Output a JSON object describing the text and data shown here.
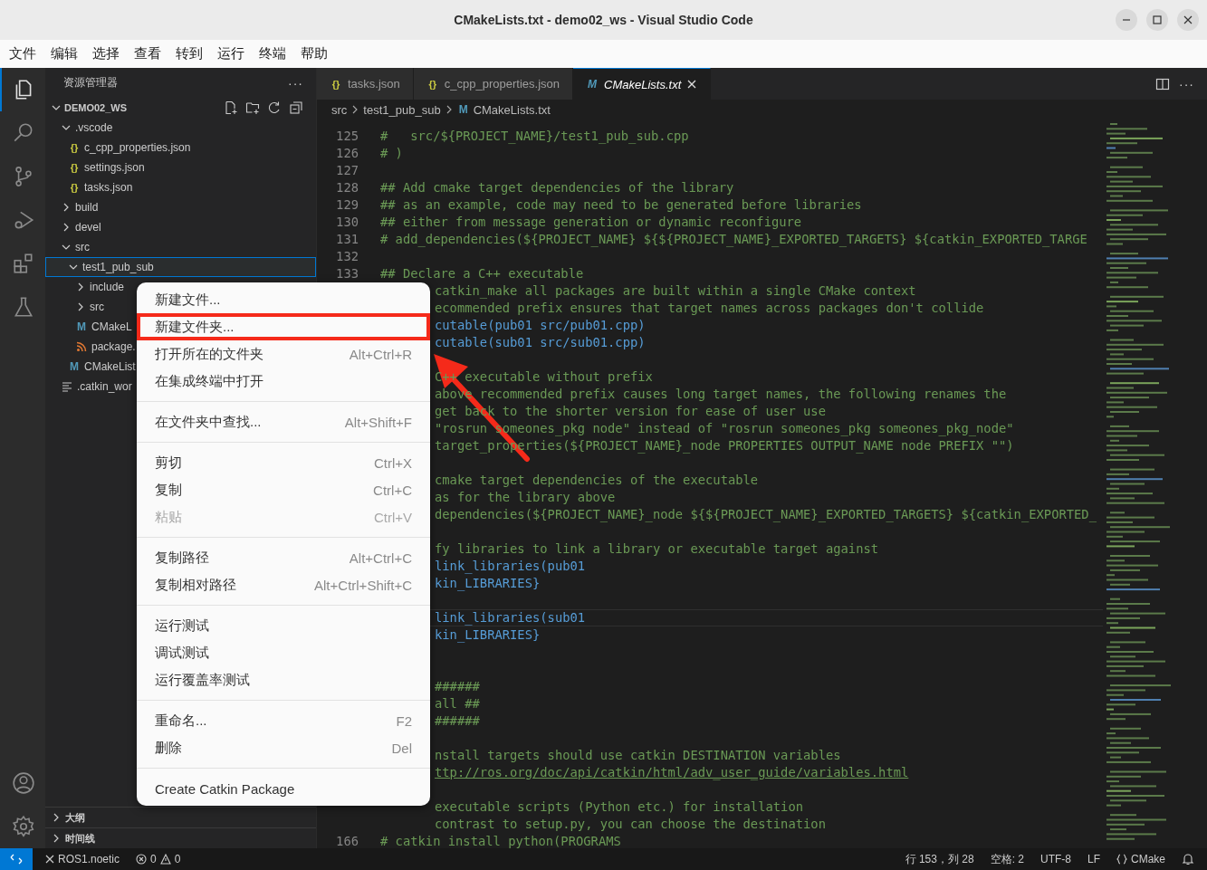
{
  "window": {
    "title": "CMakeLists.txt - demo02_ws - Visual Studio Code"
  },
  "menu_bar": [
    "文件",
    "编辑",
    "选择",
    "查看",
    "转到",
    "运行",
    "终端",
    "帮助"
  ],
  "activity_bar": [
    {
      "kind": "explorer",
      "selected": true
    },
    {
      "kind": "search",
      "selected": false
    },
    {
      "kind": "source-control",
      "selected": false
    },
    {
      "kind": "run-debug",
      "selected": false
    },
    {
      "kind": "extensions",
      "selected": false
    },
    {
      "kind": "testing",
      "selected": false
    }
  ],
  "activity_bottom": [
    {
      "kind": "account"
    },
    {
      "kind": "settings"
    }
  ],
  "sidebar": {
    "title": "资源管理器",
    "more": "···",
    "root": {
      "label": "DEMO02_WS",
      "expanded": true
    },
    "tree": [
      {
        "label": ".vscode",
        "kind": "folder",
        "expanded": true,
        "selected": false,
        "children": [
          {
            "label": "c_cpp_properties.json",
            "kind": "json",
            "icon": "{}",
            "selected": false
          },
          {
            "label": "settings.json",
            "kind": "json",
            "icon": "{}",
            "selected": false
          },
          {
            "label": "tasks.json",
            "kind": "json",
            "icon": "{}",
            "selected": false
          }
        ]
      },
      {
        "label": "build",
        "kind": "folder",
        "expanded": false,
        "selected": false
      },
      {
        "label": "devel",
        "kind": "folder",
        "expanded": false,
        "selected": false
      },
      {
        "label": "src",
        "kind": "folder",
        "expanded": true,
        "selected": false,
        "children": [
          {
            "label": "test1_pub_sub",
            "kind": "folder",
            "expanded": true,
            "selected": true,
            "children": [
              {
                "label": "include",
                "kind": "folder",
                "expanded": false,
                "selected": false
              },
              {
                "label": "src",
                "kind": "folder",
                "expanded": false,
                "selected": false
              },
              {
                "label": "CMakeL",
                "kind": "cmake",
                "icon": "M",
                "selected": false
              },
              {
                "label": "package.",
                "kind": "xml",
                "selected": false
              }
            ]
          },
          {
            "label": "CMakeList",
            "kind": "cmake",
            "icon": "M",
            "selected": false
          }
        ]
      },
      {
        "label": ".catkin_wor",
        "kind": "text",
        "selected": false
      }
    ],
    "sections": [
      {
        "label": "大纲",
        "expanded": false
      },
      {
        "label": "时间线",
        "expanded": false
      }
    ]
  },
  "tabs": [
    {
      "label": "tasks.json",
      "icon": "{}",
      "kind": "json",
      "selected": false
    },
    {
      "label": "c_cpp_properties.json",
      "icon": "{}",
      "kind": "json",
      "selected": false
    },
    {
      "label": "CMakeLists.txt",
      "icon": "M",
      "kind": "cmake",
      "selected": true
    }
  ],
  "editor_actions": {
    "more": "···"
  },
  "breadcrumb": [
    {
      "label": "src"
    },
    {
      "label": "test1_pub_sub"
    },
    {
      "label": "CMakeLists.txt",
      "icon": "M"
    }
  ],
  "editor": {
    "lines": [
      {
        "number": "125",
        "text": "#   src/${PROJECT_NAME}/test1_pub_sub.cpp",
        "kind": "comment",
        "current": false
      },
      {
        "number": "126",
        "text": "# )",
        "kind": "comment",
        "current": false
      },
      {
        "number": "127",
        "current": false
      },
      {
        "number": "128",
        "text": "## Add cmake target dependencies of the library",
        "kind": "comment",
        "current": false
      },
      {
        "number": "129",
        "text": "## as an example, code may need to be generated before libraries",
        "kind": "comment",
        "current": false
      },
      {
        "number": "130",
        "text": "## either from message generation or dynamic reconfigure",
        "kind": "comment",
        "current": false
      },
      {
        "number": "131",
        "text": "# add_dependencies(${PROJECT_NAME} ${${PROJECT_NAME}_EXPORTED_TARGETS} ${catkin_EXPORTED_TARGE",
        "kind": "comment",
        "current": false
      },
      {
        "number": "132",
        "current": false
      },
      {
        "number": "133",
        "text": "## Declare a C++ executable",
        "kind": "comment",
        "current": false
      },
      {
        "text": "catkin_make all packages are built within a single CMake context",
        "kind": "comment",
        "current": false
      },
      {
        "text": "ecommended prefix ensures that target names across packages don't collide",
        "kind": "comment",
        "current": false
      },
      {
        "text": "cutable(pub01 src/pub01.cpp)",
        "kind": "call",
        "current": false
      },
      {
        "text": "cutable(sub01 src/sub01.cpp)",
        "kind": "call",
        "current": false
      },
      {
        "current": false
      },
      {
        "text": "C++ executable without prefix",
        "kind": "comment",
        "current": false
      },
      {
        "text": "above recommended prefix causes long target names, the following renames the",
        "kind": "comment",
        "current": false
      },
      {
        "text": "get back to the shorter version for ease of user use",
        "kind": "comment",
        "current": false
      },
      {
        "text": "\"rosrun someones_pkg node\" instead of \"rosrun someones_pkg someones_pkg_node\"",
        "kind": "comment",
        "current": false
      },
      {
        "text": "target_properties(${PROJECT_NAME}_node PROPERTIES OUTPUT_NAME node PREFIX \"\")",
        "kind": "comment",
        "current": false
      },
      {
        "current": false
      },
      {
        "text": "cmake target dependencies of the executable",
        "kind": "comment",
        "current": false
      },
      {
        "text": "as for the library above",
        "kind": "comment",
        "current": false
      },
      {
        "text": "dependencies(${PROJECT_NAME}_node ${${PROJECT_NAME}_EXPORTED_TARGETS} ${catkin_EXPORTED_",
        "kind": "comment",
        "current": false
      },
      {
        "current": false
      },
      {
        "text": "fy libraries to link a library or executable target against",
        "kind": "comment",
        "current": false
      },
      {
        "text": "link_libraries(pub01",
        "kind": "call",
        "current": false
      },
      {
        "text": "kin_LIBRARIES}",
        "kind": "call",
        "current": false
      },
      {
        "current": false
      },
      {
        "text": "link_libraries(sub01",
        "kind": "call",
        "current": true
      },
      {
        "text": "kin_LIBRARIES}",
        "kind": "call",
        "current": false
      },
      {
        "current": false
      },
      {
        "current": false
      },
      {
        "text": "######",
        "kind": "comment",
        "current": false
      },
      {
        "text": "all ##",
        "kind": "comment",
        "current": false
      },
      {
        "text": "######",
        "kind": "comment",
        "current": false
      },
      {
        "current": false
      },
      {
        "text": "nstall targets should use catkin DESTINATION variables",
        "kind": "comment",
        "current": false
      },
      {
        "text": "ttp://ros.org/doc/api/catkin/html/adv_user_guide/variables.html",
        "kind": "link",
        "current": false
      },
      {
        "current": false
      },
      {
        "text": "executable scripts (Python etc.) for installation",
        "kind": "comment",
        "current": false
      },
      {
        "text": "contrast to setup.py, you can choose the destination",
        "kind": "comment",
        "current": false
      },
      {
        "number": "166",
        "text": "# catkin_install_python(PROGRAMS",
        "kind": "comment",
        "current": false
      }
    ]
  },
  "context_menu": {
    "groups": [
      [
        {
          "label": "新建文件...",
          "highlighted": false
        },
        {
          "label": "新建文件夹...",
          "highlighted": true
        },
        {
          "label": "打开所在的文件夹",
          "shortcut": "Alt+Ctrl+R",
          "highlighted": false
        },
        {
          "label": "在集成终端中打开",
          "highlighted": false
        }
      ],
      [
        {
          "label": "在文件夹中查找...",
          "shortcut": "Alt+Shift+F",
          "highlighted": false
        }
      ],
      [
        {
          "label": "剪切",
          "shortcut": "Ctrl+X",
          "disabled": false,
          "highlighted": false
        },
        {
          "label": "复制",
          "shortcut": "Ctrl+C",
          "disabled": false,
          "highlighted": false
        },
        {
          "label": "粘贴",
          "shortcut": "Ctrl+V",
          "disabled": true,
          "highlighted": false
        }
      ],
      [
        {
          "label": "复制路径",
          "shortcut": "Alt+Ctrl+C",
          "highlighted": false
        },
        {
          "label": "复制相对路径",
          "shortcut": "Alt+Ctrl+Shift+C",
          "highlighted": false
        }
      ],
      [
        {
          "label": "运行测试",
          "highlighted": false
        },
        {
          "label": "调试测试",
          "highlighted": false
        },
        {
          "label": "运行覆盖率测试",
          "highlighted": false
        }
      ],
      [
        {
          "label": "重命名...",
          "shortcut": "F2",
          "highlighted": false
        },
        {
          "label": "删除",
          "shortcut": "Del",
          "highlighted": false
        }
      ],
      [
        {
          "label": "Create Catkin Package",
          "highlighted": false
        }
      ]
    ]
  },
  "status_bar": {
    "left": [
      {
        "kind": "profile",
        "text": "ROS1.noetic"
      },
      {
        "kind": "problems",
        "errors": "0",
        "warnings": "0"
      }
    ],
    "right": [
      {
        "text": "行 153，列 28"
      },
      {
        "text": "空格: 2"
      },
      {
        "text": "UTF-8"
      },
      {
        "text": "LF"
      },
      {
        "text": "CMake",
        "kind": "language"
      },
      {
        "kind": "notifications"
      }
    ]
  }
}
